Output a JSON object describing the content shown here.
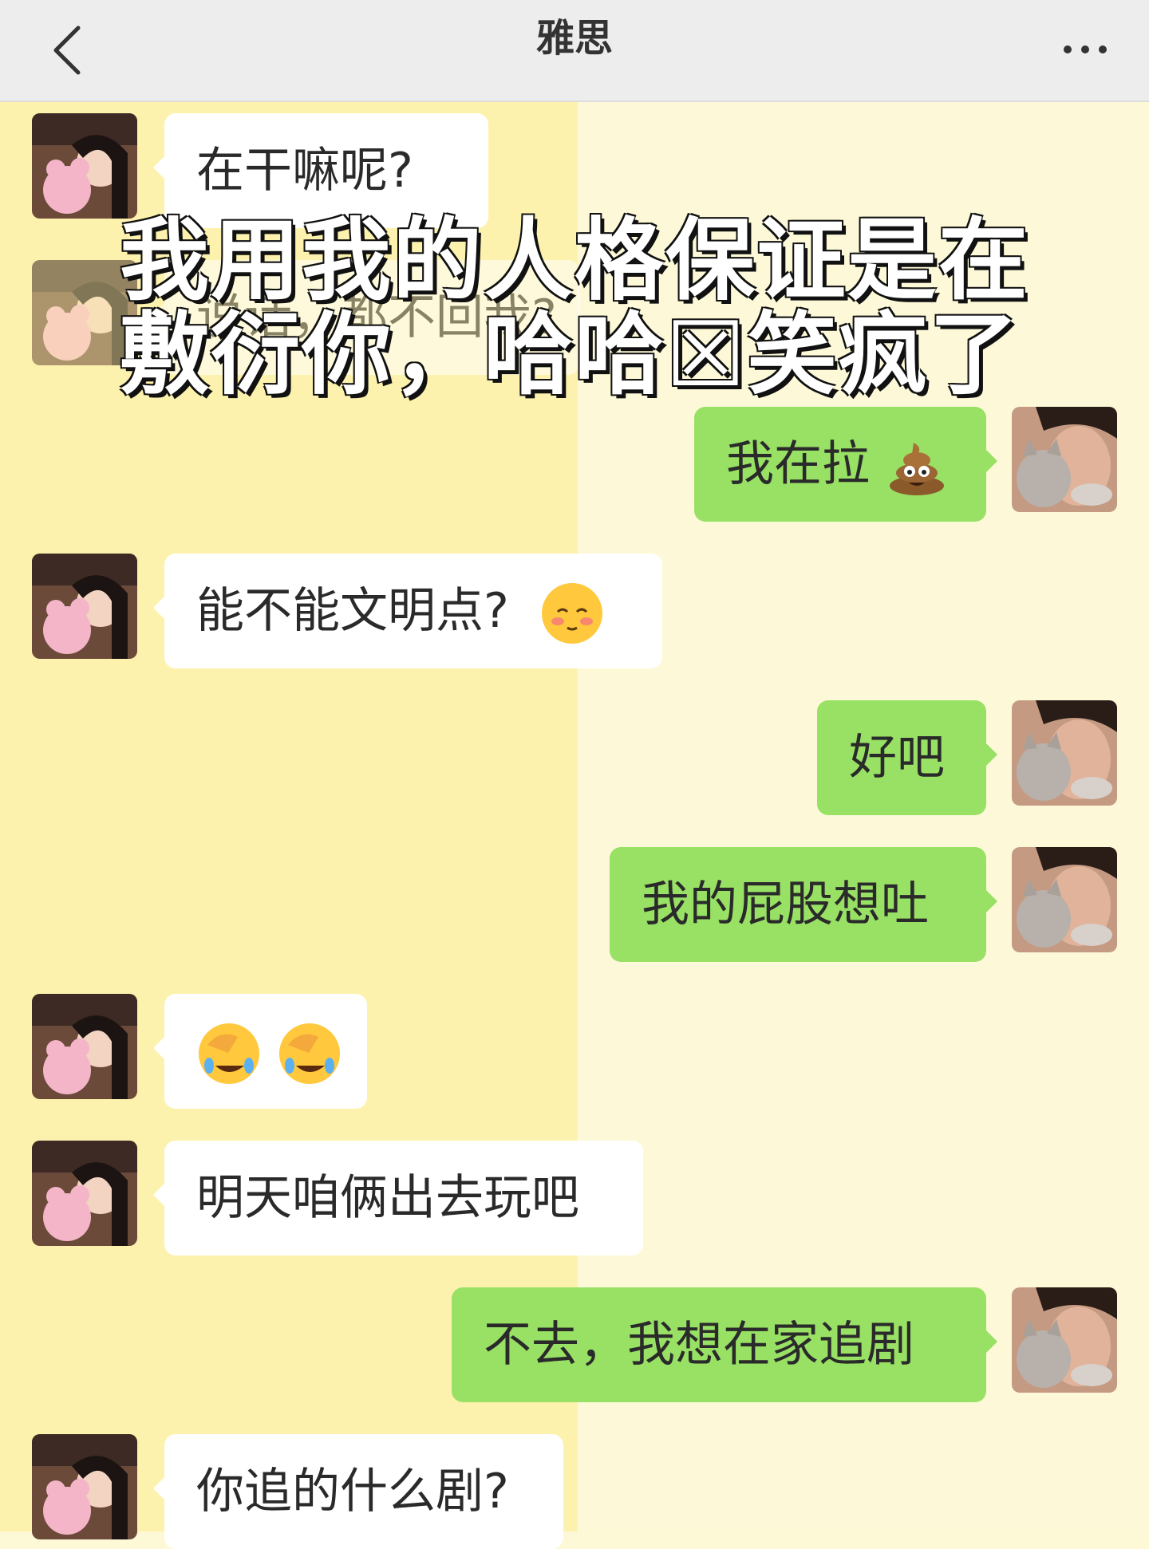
{
  "header": {
    "title": "雅思",
    "back_icon": "chevron-left-icon",
    "more_icon": "more-dots-icon"
  },
  "overlay": {
    "line1": "我用我的人格保证是在",
    "line2": "敷衍你，哈哈☒笑疯了"
  },
  "messages": [
    {
      "side": "in",
      "text": "在干嘛呢?"
    },
    {
      "side": "in",
      "text": "说话，都不回我?"
    },
    {
      "side": "out",
      "text": "我在拉",
      "emoji": "poop-emoji"
    },
    {
      "side": "in",
      "text": "能不能文明点?",
      "emoji": "blushing-face-emoji"
    },
    {
      "side": "out",
      "text": "好吧"
    },
    {
      "side": "out",
      "text": "我的屁股想吐"
    },
    {
      "side": "in",
      "text": "",
      "emoji": "face-palm-laugh-emoji x2"
    },
    {
      "side": "in",
      "text": "明天咱俩出去玩吧"
    },
    {
      "side": "out",
      "text": "不去，我想在家追剧"
    },
    {
      "side": "in",
      "text": "你追的什么剧?"
    }
  ]
}
